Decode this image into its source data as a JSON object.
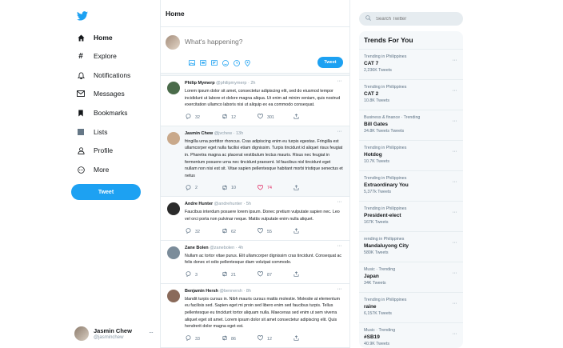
{
  "sidebar": {
    "logo": "twitter-bird-icon",
    "nav": [
      {
        "label": "Home",
        "icon": "home-icon",
        "active": true
      },
      {
        "label": "Explore",
        "icon": "hashtag-icon"
      },
      {
        "label": "Notifications",
        "icon": "bell-icon"
      },
      {
        "label": "Messages",
        "icon": "envelope-icon"
      },
      {
        "label": "Bookmarks",
        "icon": "bookmark-icon"
      },
      {
        "label": "Lists",
        "icon": "list-icon"
      },
      {
        "label": "Profile",
        "icon": "user-icon"
      },
      {
        "label": "More",
        "icon": "more-circle-icon"
      }
    ],
    "tweet_button": "Tweet",
    "profile": {
      "name": "Jasmin Chew",
      "handle": "@jasminchew",
      "more": "···"
    }
  },
  "feed": {
    "title": "Home",
    "composer": {
      "placeholder": "What's happening?",
      "tweet_button": "Tweet"
    },
    "tweets": [
      {
        "name": "Philip Mymerp",
        "handle": "@philipmymerp",
        "time": "2h",
        "text": "Lorem ipsum dolor sit amet, consectetur adipiscing elit, sed do eiusmod tempor incididunt ut labore et dolore magna aliqua. Ut enim ad minim veniam, quis nostrud exercitation ullamco laboris nisi ut aliquip ex ea commodo consequat.",
        "replies": "32",
        "retweets": "12",
        "likes": "301"
      },
      {
        "name": "Jasmin Chew",
        "handle": "@jvchew",
        "time": "13h",
        "text": "fringilla urna porttitor rhoncus. Cras adipiscing enim eu turpis egestas. Fringilla est ullamcorper eget nulla facilisi etiam dignissim. Turpis tincidunt id aliquet risus feugiat in. Pharetra magna ac placerat vestibulum lectus mauris. Risus nec feugiat in fermentum posuere urna nec tincidunt praesent. Id faucibus nisl tincidunt eget nullam non nisi est sit. Vitae sapien pellentesque habitant morbi tristique senectus et netus",
        "replies": "2",
        "retweets": "10",
        "likes": "74",
        "liked": true
      },
      {
        "name": "Andre Hunter",
        "handle": "@andrehunter",
        "time": "5h",
        "text": "Faucibus interdum posuere lorem ipsum. Donec pretium vulputate sapien nec. Leo vel orci porta non pulvinar neque. Mattis vulputate enim nulla aliquet.",
        "replies": "32",
        "retweets": "62",
        "likes": "55"
      },
      {
        "name": "Zane Bolen",
        "handle": "@zanebolen",
        "time": "4h",
        "text": "Nullam ac tortor vitae purus. Elit ullamcorper dignissim cras tincidunt. Consequat ac felis donec et odio pellentesque diam volutpat commodo.",
        "replies": "3",
        "retweets": "21",
        "likes": "87"
      },
      {
        "name": "Benjamin Hersh",
        "handle": "@bennersh",
        "time": "8h",
        "text": "blandit turpis cursus in. Nibh mauris cursus mattis molestie. Molestie at elementum eu facilisis sed. Sapien eget mi proin sed libero enim sed faucibus turpis. Tellus pellentesque eu tincidunt tortor aliquam nulla. Maecenas sed enim ut sem viverra aliquet eget sit amet. Lorem ipsum dolor sit amet consectetur adipiscing elit. Quis hendrerit dolor magna eget est.",
        "replies": "33",
        "retweets": "86",
        "likes": "12"
      }
    ]
  },
  "right": {
    "search_placeholder": "Search Twitter",
    "trends_title": "Trends For You",
    "trends": [
      {
        "context": "Trending in Philippines",
        "name": "CAT 7",
        "count": "2,236K Tweets"
      },
      {
        "context": "Trending in Philippines",
        "name": "CAT 2",
        "count": "10.8K Tweets"
      },
      {
        "context": "Business & finance · Trending",
        "name": "Bill Gates",
        "count": "34.8K Tweets Tweets"
      },
      {
        "context": "Trending in Philippines",
        "name": "Hotdog",
        "count": "10.7K Tweets"
      },
      {
        "context": "Trending in Philippines",
        "name": "Extraordinary You",
        "count": "5,377k Tweets"
      },
      {
        "context": "Trending in Philippines",
        "name": "President-elect",
        "count": "167K Tweets"
      },
      {
        "context": "rending in Philippines",
        "name": "Mandaluyong City",
        "count": "580K Tweets"
      },
      {
        "context": "Music · Trending",
        "name": "Japan",
        "count": "34K Tweets"
      },
      {
        "context": "Trending in Philippines",
        "name": "raine",
        "count": "6,157K Tweets"
      },
      {
        "context": "Music · Trending",
        "name": "#SB19",
        "count": "40.9K Tweets"
      }
    ]
  },
  "colors": {
    "accent": "#1da1f2",
    "like": "#e0245e",
    "muted": "#8899a6",
    "panel": "#f5f8fa"
  }
}
